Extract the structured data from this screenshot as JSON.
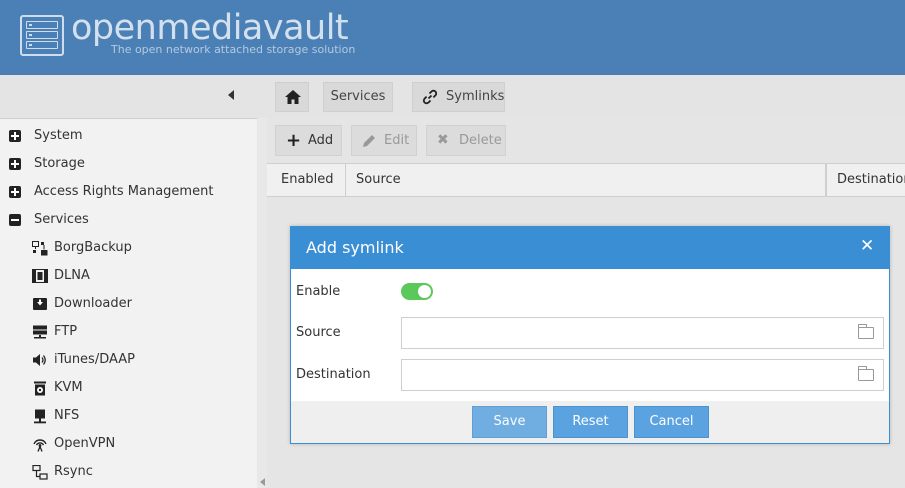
{
  "brand": {
    "title": "openmediavault",
    "subtitle": "The open network attached storage solution"
  },
  "breadcrumb": {
    "home_icon": "home-icon",
    "services": "Services",
    "symlinks": "Symlinks",
    "symlinks_icon": "link-icon"
  },
  "sidebar": {
    "items": [
      {
        "label": "System",
        "expanded": false
      },
      {
        "label": "Storage",
        "expanded": false
      },
      {
        "label": "Access Rights Management",
        "expanded": false
      },
      {
        "label": "Services",
        "expanded": true
      }
    ],
    "sub_items": [
      {
        "label": "BorgBackup",
        "icon": "borgbackup-icon"
      },
      {
        "label": "DLNA",
        "icon": "film-icon"
      },
      {
        "label": "Downloader",
        "icon": "download-icon"
      },
      {
        "label": "FTP",
        "icon": "server-icon"
      },
      {
        "label": "iTunes/DAAP",
        "icon": "speaker-icon"
      },
      {
        "label": "KVM",
        "icon": "kvm-icon"
      },
      {
        "label": "NFS",
        "icon": "nfs-icon"
      },
      {
        "label": "OpenVPN",
        "icon": "wifi-icon"
      },
      {
        "label": "Rsync",
        "icon": "network-icon"
      }
    ]
  },
  "toolbar": {
    "add": "Add",
    "edit": "Edit",
    "delete": "Delete"
  },
  "grid": {
    "columns": [
      "Enabled",
      "Source",
      "Destination"
    ]
  },
  "dialog": {
    "title": "Add symlink",
    "enable_label": "Enable",
    "enable_value": true,
    "source_label": "Source",
    "source_value": "",
    "destination_label": "Destination",
    "destination_value": "",
    "save": "Save",
    "reset": "Reset",
    "cancel": "Cancel"
  },
  "colors": {
    "header": "#4a80b5",
    "dialog_accent": "#3a8ed4",
    "button": "#5aa3e0",
    "toggle_on": "#5ac85a"
  }
}
